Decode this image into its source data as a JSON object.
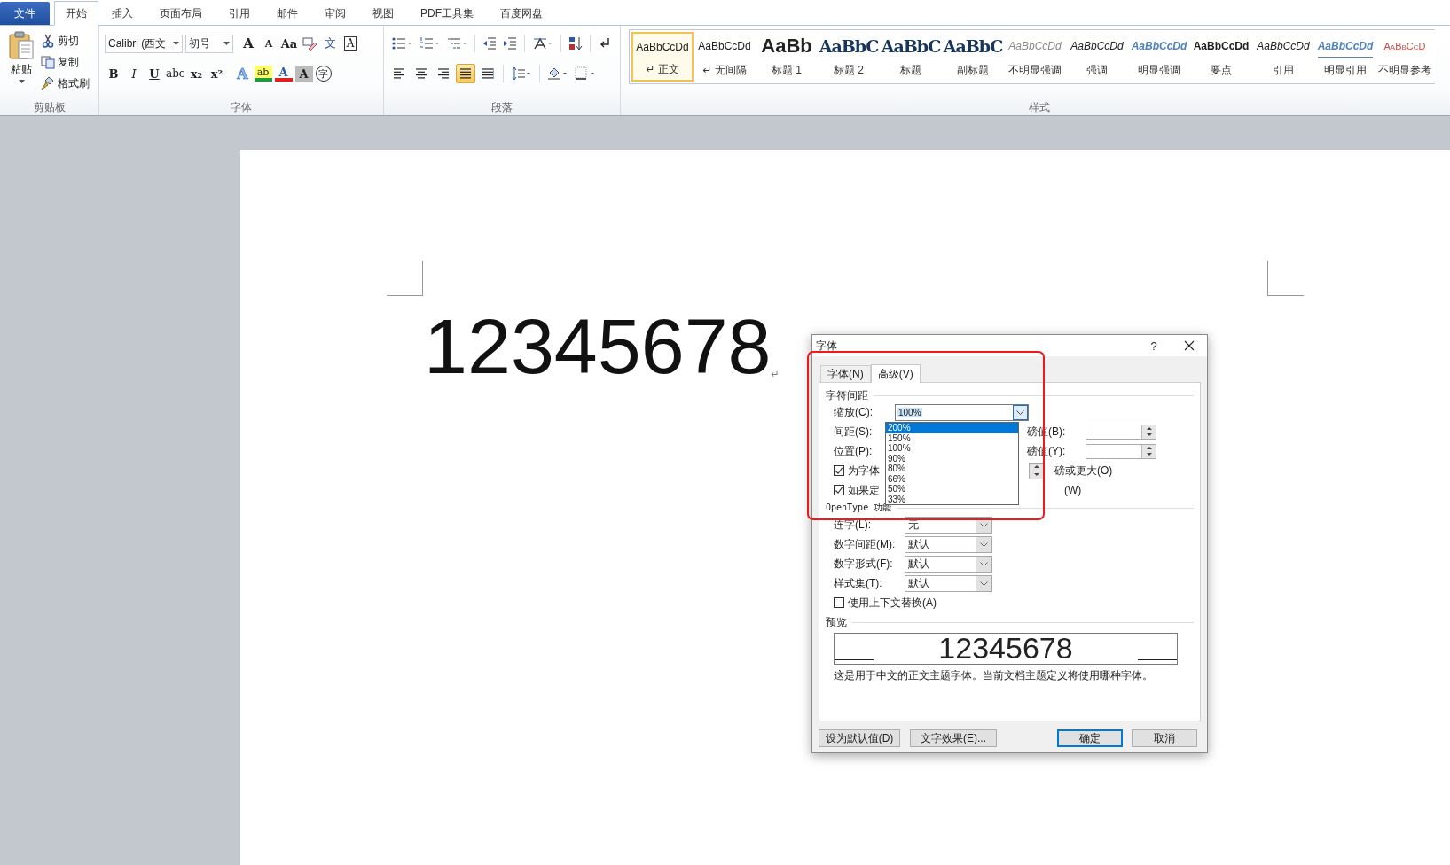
{
  "ribbon_tabs": [
    {
      "label": "文件",
      "kind": "file",
      "selected": false
    },
    {
      "label": "开始",
      "kind": "tab",
      "selected": true
    },
    {
      "label": "插入",
      "kind": "tab",
      "selected": false
    },
    {
      "label": "页面布局",
      "kind": "tab",
      "selected": false
    },
    {
      "label": "引用",
      "kind": "tab",
      "selected": false
    },
    {
      "label": "邮件",
      "kind": "tab",
      "selected": false
    },
    {
      "label": "审阅",
      "kind": "tab",
      "selected": false
    },
    {
      "label": "视图",
      "kind": "tab",
      "selected": false
    },
    {
      "label": "PDF工具集",
      "kind": "tab",
      "selected": false
    },
    {
      "label": "百度网盘",
      "kind": "tab",
      "selected": false
    }
  ],
  "clipboard": {
    "paste": "粘贴",
    "actions": [
      {
        "label": "剪切",
        "kind": "cut"
      },
      {
        "label": "复制",
        "kind": "copy"
      },
      {
        "label": "格式刷",
        "kind": "painter"
      }
    ],
    "group_label": "剪贴板"
  },
  "font": {
    "name": "Calibri (西文",
    "size": "初号",
    "group_label": "字体",
    "top_buttons": [
      {
        "label": "A",
        "kind": "grow"
      },
      {
        "label": "A",
        "kind": "shrink"
      },
      {
        "label": "Aa",
        "kind": "case"
      },
      {
        "kind": "clear"
      },
      {
        "label": "文",
        "kind": "phonetic"
      },
      {
        "label": "A",
        "kind": "border"
      }
    ],
    "bottom_buttons": [
      {
        "label": "B",
        "kind": "bold"
      },
      {
        "label": "I",
        "kind": "italic"
      },
      {
        "label": "U",
        "kind": "underline"
      },
      {
        "label": "abc",
        "kind": "strike"
      },
      {
        "label": "x₂",
        "kind": "sub"
      },
      {
        "label": "x²",
        "kind": "sup"
      },
      {
        "label": "A",
        "kind": "effect"
      },
      {
        "label": "ab",
        "kind": "highlight"
      },
      {
        "label": "A",
        "kind": "color"
      },
      {
        "label": "A",
        "kind": "shading"
      },
      {
        "label": "字",
        "kind": "enclose"
      }
    ]
  },
  "paragraph": {
    "group_label": "段落",
    "align_buttons": [
      {
        "kind": "left",
        "selected": false
      },
      {
        "kind": "center",
        "selected": false
      },
      {
        "kind": "right",
        "selected": false
      },
      {
        "kind": "justify",
        "selected": true
      },
      {
        "kind": "distributed",
        "selected": false
      }
    ]
  },
  "styles": {
    "group_label": "样式",
    "items": [
      {
        "preview": "AaBbCcDd",
        "label": "↵ 正文",
        "kind": "normal",
        "selected": true
      },
      {
        "preview": "AaBbCcDd",
        "label": "↵ 无间隔",
        "kind": "normal",
        "selected": false
      },
      {
        "preview": "AaBb",
        "label": "标题 1",
        "kind": "heading1",
        "selected": false
      },
      {
        "preview": "AaBbC",
        "label": "标题 2",
        "kind": "heading",
        "selected": false
      },
      {
        "preview": "AaBbC",
        "label": "标题",
        "kind": "heading",
        "selected": false
      },
      {
        "preview": "AaBbC",
        "label": "副标题",
        "kind": "heading",
        "selected": false
      },
      {
        "preview": "AaBbCcDd",
        "label": "不明显强调",
        "kind": "subtle",
        "selected": false
      },
      {
        "preview": "AaBbCcDd",
        "label": "强调",
        "kind": "emphasis",
        "selected": false
      },
      {
        "preview": "AaBbCcDd",
        "label": "明显强调",
        "kind": "intense",
        "selected": false
      },
      {
        "preview": "AaBbCcDd",
        "label": "要点",
        "kind": "strong",
        "selected": false
      },
      {
        "preview": "AaBbCcDd",
        "label": "引用",
        "kind": "emphasis",
        "selected": false
      },
      {
        "preview": "AaBbCcDd",
        "label": "明显引用",
        "kind": "intense-quote",
        "selected": false
      },
      {
        "preview": "AaBbCcD",
        "label": "不明显参考",
        "kind": "subtle-ref",
        "selected": false
      }
    ]
  },
  "document": {
    "text": "12345678",
    "paragraph_mark": "↵"
  },
  "dialog": {
    "title": "字体",
    "help": "?",
    "tabs": [
      {
        "label": "字体(N)",
        "selected": false
      },
      {
        "label": "高级(V)",
        "selected": true
      }
    ],
    "spacing_section": "字符间距",
    "scale": {
      "label": "缩放(C):",
      "value": "100%",
      "expanded": true,
      "options": [
        {
          "label": "200%",
          "highlighted": true
        },
        {
          "label": "150%",
          "highlighted": false
        },
        {
          "label": "100%",
          "highlighted": false
        },
        {
          "label": "90%",
          "highlighted": false
        },
        {
          "label": "80%",
          "highlighted": false
        },
        {
          "label": "66%",
          "highlighted": false
        },
        {
          "label": "50%",
          "highlighted": false
        },
        {
          "label": "33%",
          "highlighted": false
        }
      ]
    },
    "spacing": {
      "label": "间距(S):",
      "points_label": "磅值(B):"
    },
    "position": {
      "label": "位置(P):",
      "points_label": "磅值(Y):"
    },
    "kerning": {
      "label": "为字体",
      "checked": true,
      "suffix": "磅或更大(O)"
    },
    "grid": {
      "label": "如果定",
      "checked": true,
      "suffix": "(W)"
    },
    "opentype_section": "OpenType 功能",
    "opentype": [
      {
        "label": "连字(L):",
        "value": "无"
      },
      {
        "label": "数字间距(M):",
        "value": "默认"
      },
      {
        "label": "数字形式(F):",
        "value": "默认"
      },
      {
        "label": "样式集(T):",
        "value": "默认"
      }
    ],
    "contextual": {
      "label": "使用上下文替换(A)",
      "checked": false
    },
    "preview_section": "预览",
    "preview_text": "12345678",
    "preview_note": "这是用于中文的正文主题字体。当前文档主题定义将使用哪种字体。",
    "buttons": [
      {
        "label": "设为默认值(D)",
        "kind": "plain"
      },
      {
        "label": "文字效果(E)...",
        "kind": "plain"
      },
      {
        "label": "确定",
        "kind": "default"
      },
      {
        "label": "取消",
        "kind": "plain"
      }
    ]
  }
}
